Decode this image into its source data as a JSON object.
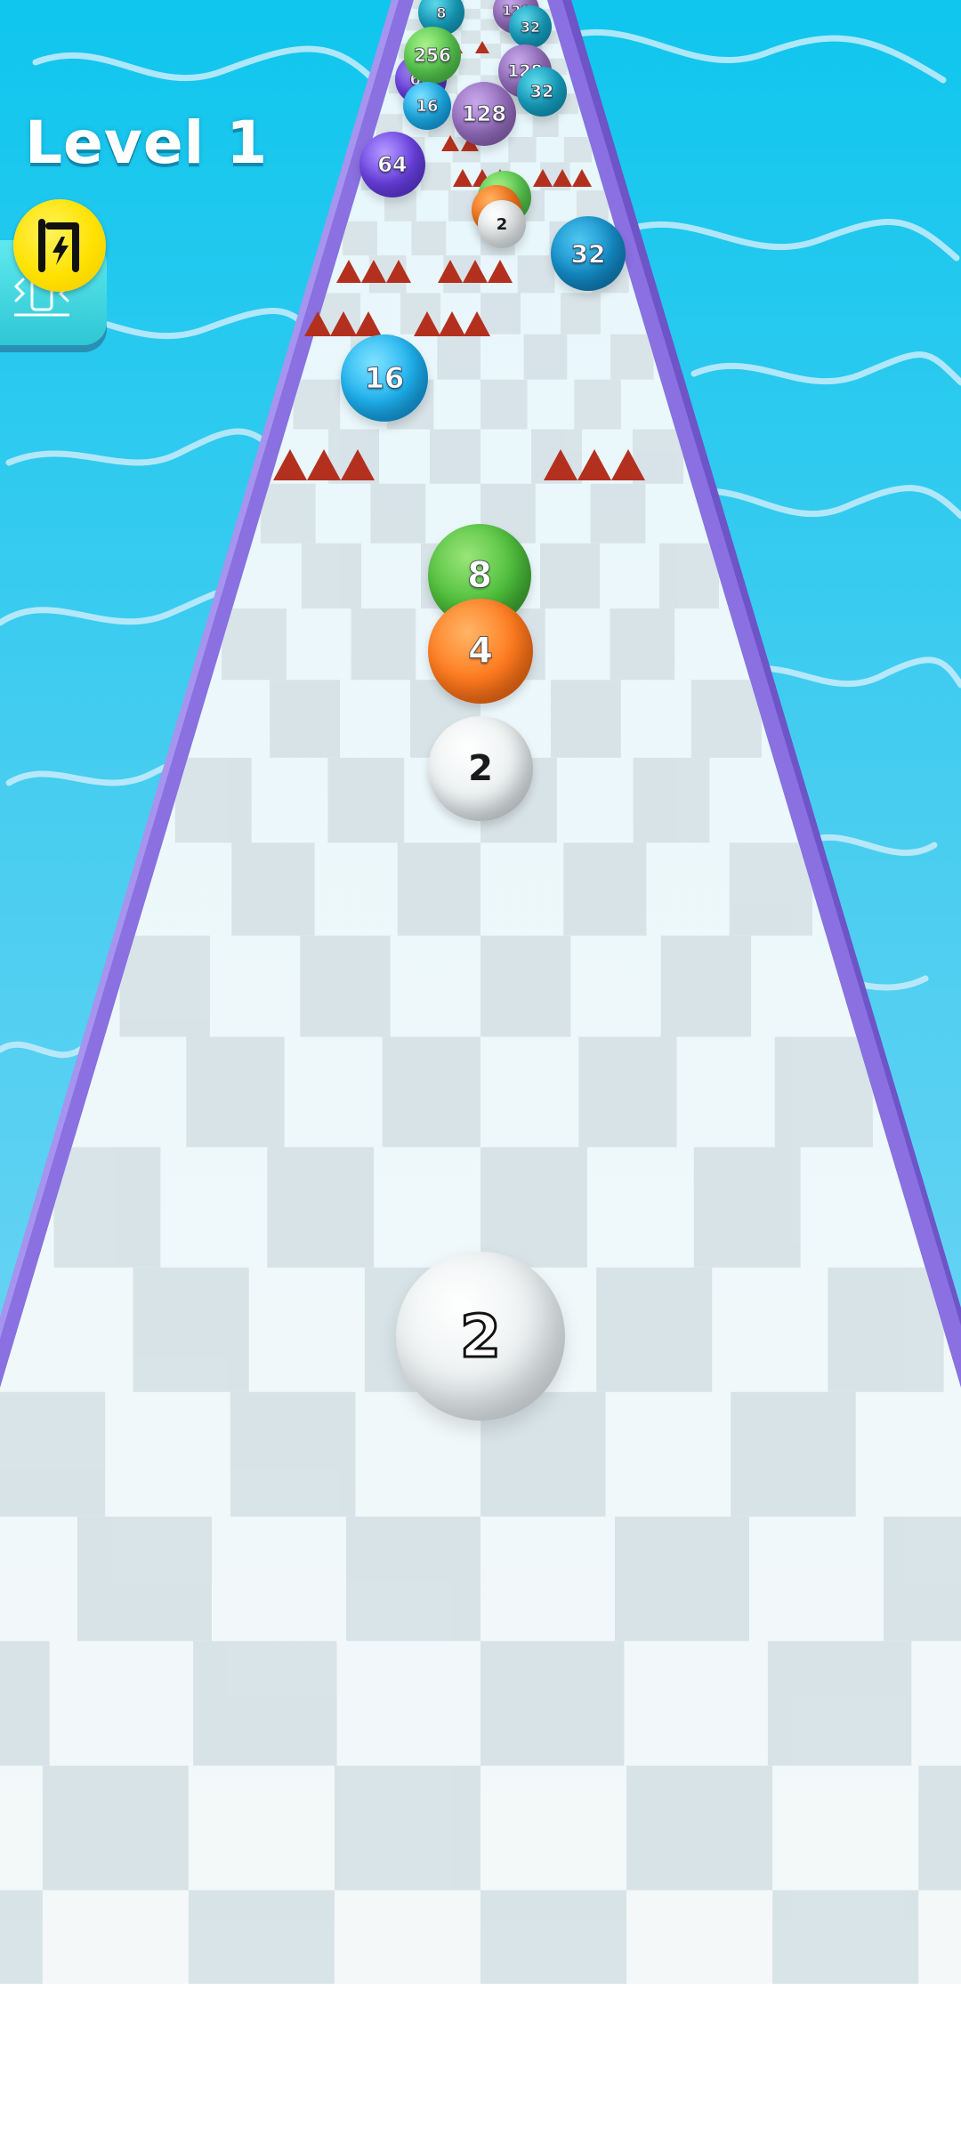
{
  "hud": {
    "level_label": "Level 1"
  },
  "icons": {
    "boost": "boost-icon",
    "vibration": "vibration-icon"
  },
  "colors": {
    "sky": "#1ec8ef",
    "water_swirl": "#bfe9fb",
    "rail": "#8a70e0",
    "track_light": "#f4fbfd",
    "track_dark": "#d6e1e6",
    "spike": "#b4301e",
    "boost_button": "#ffe100"
  },
  "balls": [
    {
      "id": "player-ball",
      "value": "2",
      "color": "white"
    },
    {
      "id": "ball-2-near",
      "value": "2",
      "color": "white"
    },
    {
      "id": "ball-4",
      "value": "4",
      "color": "orange"
    },
    {
      "id": "ball-8",
      "value": "8",
      "color": "green"
    },
    {
      "id": "ball-16-left",
      "value": "16",
      "color": "cyan"
    },
    {
      "id": "ball-32-right",
      "value": "32",
      "color": "blue"
    },
    {
      "id": "ball-64-left",
      "value": "64",
      "color": "purple"
    },
    {
      "id": "ball-2-far",
      "value": "2",
      "color": "white"
    },
    {
      "id": "ball-128-center",
      "value": "128",
      "color": "mauve"
    },
    {
      "id": "ball-16-far",
      "value": "16",
      "color": "cyan"
    },
    {
      "id": "ball-64-far",
      "value": "64",
      "color": "purple"
    },
    {
      "id": "ball-32-far",
      "value": "32",
      "color": "teal"
    },
    {
      "id": "ball-128-far",
      "value": "128",
      "color": "mauve"
    },
    {
      "id": "ball-256-far",
      "value": "256",
      "color": "lime"
    },
    {
      "id": "ball-32-top",
      "value": "32",
      "color": "teal"
    },
    {
      "id": "ball-128-top",
      "value": "128",
      "color": "mauve"
    },
    {
      "id": "ball-8-top",
      "value": "8",
      "color": "teal"
    }
  ]
}
